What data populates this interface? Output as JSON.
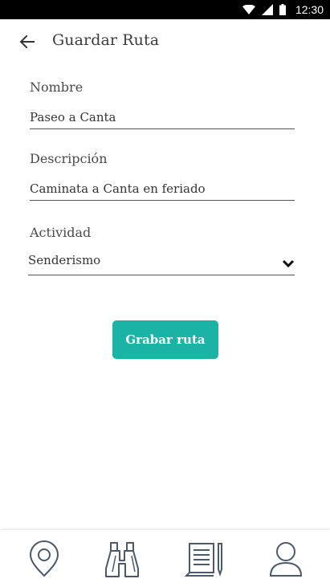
{
  "status_bar": {
    "time": "12:30"
  },
  "header": {
    "title": "Guardar Ruta"
  },
  "form": {
    "name_label": "Nombre",
    "name_value": "Paseo a Canta",
    "description_label": "Descripción",
    "description_value": "Caminata a Canta en feriado",
    "activity_label": "Actividad",
    "activity_selected": "Senderismo"
  },
  "actions": {
    "record_label": "Grabar ruta"
  },
  "bottom_nav": {
    "items": [
      {
        "icon": "location-pin-icon"
      },
      {
        "icon": "binoculars-icon"
      },
      {
        "icon": "notes-icon"
      },
      {
        "icon": "profile-icon"
      }
    ]
  },
  "colors": {
    "accent": "#1ab3a6",
    "status_bar": "#000000",
    "icon_stroke": "#4a5a6a"
  }
}
